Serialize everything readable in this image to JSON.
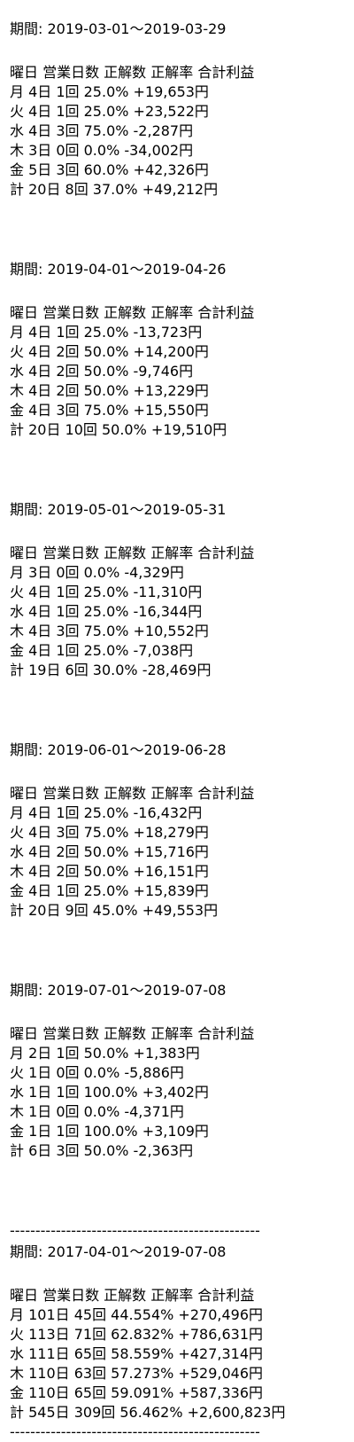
{
  "document": {
    "blocks": [
      {
        "period": "期間: 2019-03-01〜2019-03-29",
        "header": "曜日 営業日数 正解数 正解率 合計利益",
        "rows": [
          "月 4日 1回 25.0% +19,653円",
          "火 4日 1回 25.0% +23,522円",
          "水 4日 3回 75.0% -2,287円",
          "木 3日 0回 0.0% -34,002円",
          "金 5日 3回 60.0% +42,326円",
          "計 20日 8回 37.0% +49,212円"
        ]
      },
      {
        "period": "期間: 2019-04-01〜2019-04-26",
        "header": "曜日 営業日数 正解数 正解率 合計利益",
        "rows": [
          "月 4日 1回 25.0% -13,723円",
          "火 4日 2回 50.0% +14,200円",
          "水 4日 2回 50.0% -9,746円",
          "木 4日 2回 50.0% +13,229円",
          "金 4日 3回 75.0% +15,550円",
          "計 20日 10回 50.0% +19,510円"
        ]
      },
      {
        "period": "期間: 2019-05-01〜2019-05-31",
        "header": "曜日 営業日数 正解数 正解率 合計利益",
        "rows": [
          "月 3日 0回 0.0% -4,329円",
          "火 4日 1回 25.0% -11,310円",
          "水 4日 1回 25.0% -16,344円",
          "木 4日 3回 75.0% +10,552円",
          "金 4日 1回 25.0% -7,038円",
          "計 19日 6回 30.0% -28,469円"
        ]
      },
      {
        "period": "期間: 2019-06-01〜2019-06-28",
        "header": "曜日 営業日数 正解数 正解率 合計利益",
        "rows": [
          "月 4日 1回 25.0% -16,432円",
          "火 4日 3回 75.0% +18,279円",
          "水 4日 2回 50.0% +15,716円",
          "木 4日 2回 50.0% +16,151円",
          "金 4日 1回 25.0% +15,839円",
          "計 20日 9回 45.0% +49,553円"
        ]
      },
      {
        "period": "期間: 2019-07-01〜2019-07-08",
        "header": "曜日 営業日数 正解数 正解率 合計利益",
        "rows": [
          "月 2日 1回 50.0% +1,383円",
          "火 1日 0回 0.0% -5,886円",
          "水 1日 1回 100.0% +3,402円",
          "木 1日 0回 0.0% -4,371円",
          "金 1日 1回 100.0% +3,109円",
          "計 6日 3回 50.0% -2,363円"
        ]
      }
    ],
    "separator": "-------------------------------------------------",
    "summary": {
      "period": "期間: 2017-04-01〜2019-07-08",
      "header": "曜日 営業日数 正解数 正解率 合計利益",
      "rows": [
        "月 101日 45回 44.554% +270,496円",
        "火 113日 71回 62.832% +786,631円",
        "水 111日 65回 58.559% +427,314円",
        "木 110日 63回 57.273% +529,046円",
        "金 110日 65回 59.091% +587,336円",
        "計 545日 309回 56.462% +2,600,823円"
      ]
    }
  }
}
